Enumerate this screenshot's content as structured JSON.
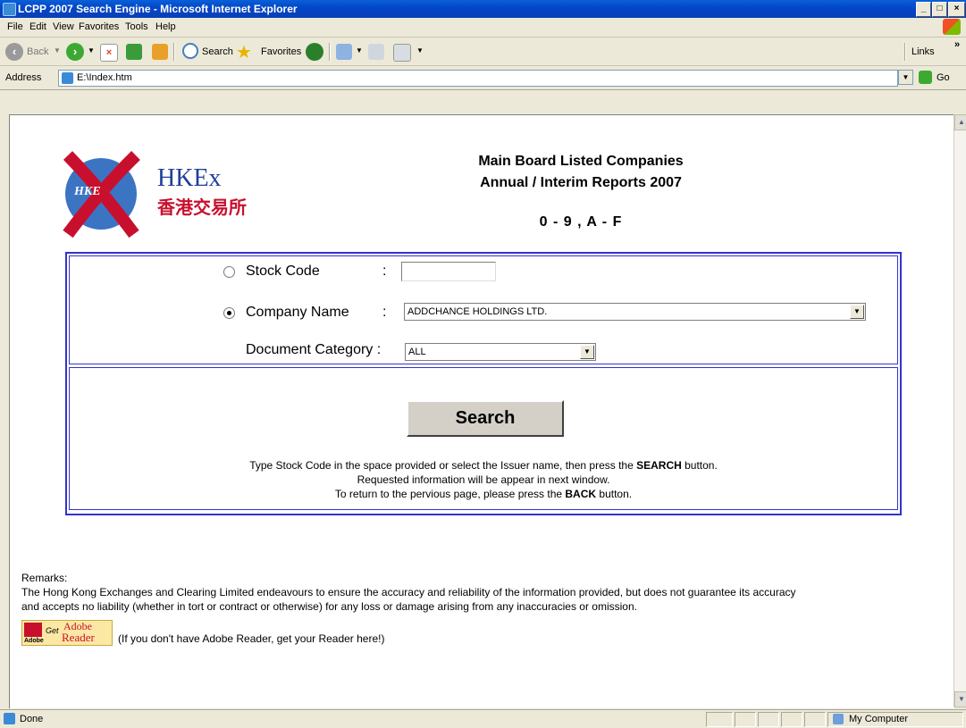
{
  "window": {
    "title": "LCPP 2007 Search Engine - Microsoft Internet Explorer"
  },
  "menu": [
    "File",
    "Edit",
    "View",
    "Favorites",
    "Tools",
    "Help"
  ],
  "toolbar": {
    "back": "Back",
    "search": "Search",
    "favorites": "Favorites",
    "links": "Links"
  },
  "address": {
    "label": "Address",
    "value": "E:\\Index.htm",
    "go": "Go"
  },
  "page": {
    "logo_text": "HKEx",
    "logo_chinese": "香港交易所",
    "logo_badge": "HKE",
    "heading_line1": "Main Board Listed Companies",
    "heading_line2": "Annual / Interim Reports 2007",
    "heading_range": "0 - 9 , A - F"
  },
  "form": {
    "stock_code_label": "Stock Code",
    "colon": ":",
    "stock_code_value": "",
    "company_name_label": "Company Name",
    "company_name_value": "ADDCHANCE HOLDINGS LTD.",
    "doc_category_label": "Document Category :",
    "doc_category_value": "ALL",
    "selected_option": "company_name",
    "search_label": "Search"
  },
  "instructions": {
    "line1_pre": "Type Stock Code in the space provided or select the Issuer name, then press the ",
    "line1_bold": "SEARCH",
    "line1_post": " button.",
    "line2": "Requested information will be appear in next window.",
    "line3_pre": "To return to the pervious page, please press the ",
    "line3_bold": "BACK",
    "line3_post": " button."
  },
  "remarks": {
    "title": "Remarks:",
    "line1": "The Hong Kong Exchanges and Clearing Limited endeavours to ensure the accuracy and reliability of the information provided, but does not guarantee its accuracy",
    "line2": "and accepts no liability (whether in tort or contract or otherwise) for any loss or damage arising from any inaccuracies or omission.",
    "adobe_get": "Get",
    "adobe_brand": "Adobe",
    "adobe_reader": "Reader",
    "adobe_small": "Adobe",
    "adobe_note": "(If you don't have Adobe Reader, get your Reader here!)"
  },
  "status": {
    "left": "Done",
    "zone": "My Computer"
  },
  "colors": {
    "panel_border": "#3333cc",
    "title_bar": "#0a5fd8"
  }
}
